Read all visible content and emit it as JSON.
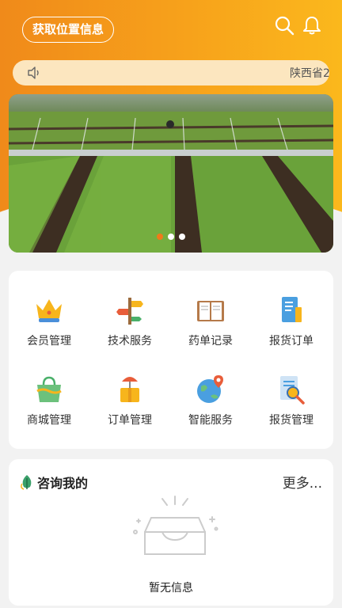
{
  "header": {
    "location_button": "获取位置信息",
    "search_icon": "search-icon",
    "bell_icon": "bell-icon"
  },
  "notice": {
    "speaker_icon": "speaker-icon",
    "text": "陕西省2"
  },
  "banner": {
    "image": "farmland-photo",
    "dots": 3,
    "active_dot": 0
  },
  "menu": {
    "items": [
      {
        "label": "会员管理",
        "icon": "crown-icon"
      },
      {
        "label": "技术服务",
        "icon": "signpost-icon"
      },
      {
        "label": "药单记录",
        "icon": "book-icon"
      },
      {
        "label": "报货订单",
        "icon": "document-icon"
      },
      {
        "label": "商城管理",
        "icon": "shopping-bag-icon"
      },
      {
        "label": "订单管理",
        "icon": "package-icon"
      },
      {
        "label": "智能服务",
        "icon": "globe-pin-icon"
      },
      {
        "label": "报货管理",
        "icon": "report-search-icon"
      }
    ]
  },
  "consult": {
    "title": "咨询我的",
    "more": "更多...",
    "empty_text": "暂无信息"
  },
  "colors": {
    "accent": "#f08a1a",
    "accent_light": "#fbb81c"
  }
}
